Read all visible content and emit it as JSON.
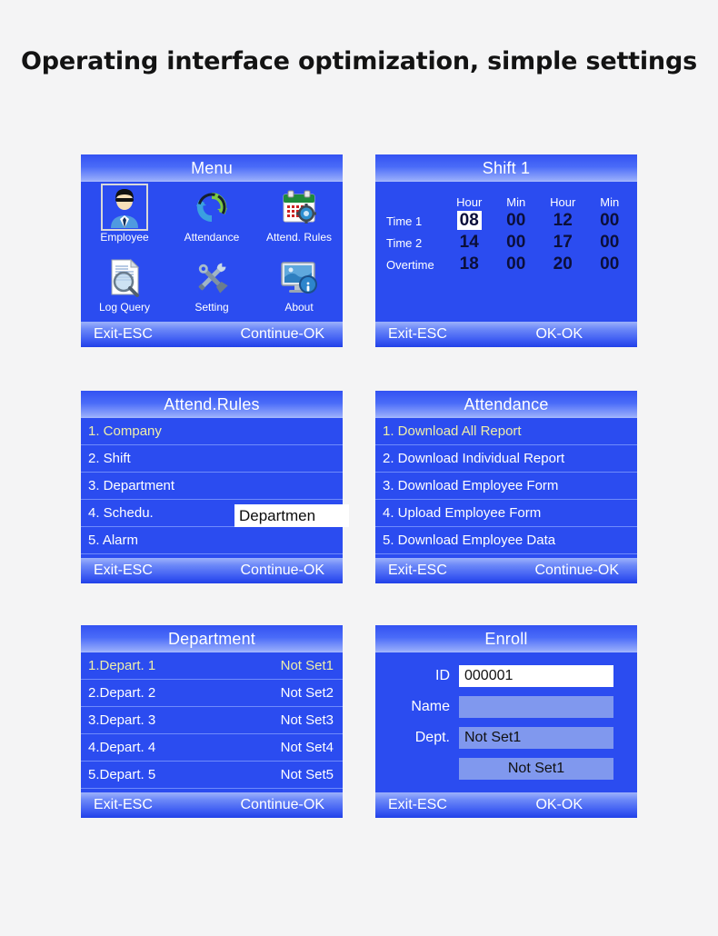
{
  "page": {
    "title": "Operating interface optimization, simple settings",
    "background": "#f4f4f5"
  },
  "colors": {
    "screen_blue": "#2b4cf0",
    "title_gradient_top": "#3352f2",
    "title_gradient_bottom": "#a9bbfc",
    "selected_text": "#eeeeaa",
    "value_text": "#0b0f3a",
    "field_tint": "#8098ee"
  },
  "panels": {
    "menu": {
      "title": "Menu",
      "items": [
        {
          "label": "Employee",
          "icon": "employee-icon",
          "selected": true
        },
        {
          "label": "Attendance",
          "icon": "attendance-icon",
          "selected": false
        },
        {
          "label": "Attend. Rules",
          "icon": "attend-rules-icon",
          "selected": false
        },
        {
          "label": "Log Query",
          "icon": "log-query-icon",
          "selected": false
        },
        {
          "label": "Setting",
          "icon": "setting-icon",
          "selected": false
        },
        {
          "label": "About",
          "icon": "about-icon",
          "selected": false
        }
      ],
      "footer_left": "Exit-ESC",
      "footer_right": "Continue-OK"
    },
    "shift": {
      "title": "Shift 1",
      "headers": [
        "Hour",
        "Min",
        "Hour",
        "Min"
      ],
      "rows": [
        {
          "label": "Time 1",
          "values": [
            "08",
            "00",
            "12",
            "00"
          ],
          "highlight_index": 0
        },
        {
          "label": "Time 2",
          "values": [
            "14",
            "00",
            "17",
            "00"
          ],
          "highlight_index": -1
        },
        {
          "label": "Overtime",
          "values": [
            "18",
            "00",
            "20",
            "00"
          ],
          "highlight_index": -1
        }
      ],
      "footer_left": "Exit-ESC",
      "footer_right": "OK-OK"
    },
    "attend_rules": {
      "title": "Attend.Rules",
      "items": [
        {
          "label": "1. Company",
          "selected": true
        },
        {
          "label": "2. Shift",
          "selected": false
        },
        {
          "label": "3. Department",
          "selected": false
        },
        {
          "label": "4. Schedu.",
          "selected": false
        },
        {
          "label": "5. Alarm",
          "selected": false
        }
      ],
      "popup_text": "Departmen",
      "footer_left": "Exit-ESC",
      "footer_right": "Continue-OK"
    },
    "attendance": {
      "title": "Attendance",
      "items": [
        {
          "label": "1. Download All Report",
          "selected": true
        },
        {
          "label": "2. Download Individual Report",
          "selected": false
        },
        {
          "label": "3. Download Employee Form",
          "selected": false
        },
        {
          "label": "4. Upload Employee Form",
          "selected": false
        },
        {
          "label": "5. Download Employee Data",
          "selected": false
        }
      ],
      "footer_left": "Exit-ESC",
      "footer_right": "Continue-OK"
    },
    "department": {
      "title": "Department",
      "items": [
        {
          "label": "1.Depart. 1",
          "value": "Not Set1",
          "selected": true
        },
        {
          "label": "2.Depart. 2",
          "value": "Not Set2",
          "selected": false
        },
        {
          "label": "3.Depart. 3",
          "value": "Not Set3",
          "selected": false
        },
        {
          "label": "4.Depart. 4",
          "value": "Not Set4",
          "selected": false
        },
        {
          "label": "5.Depart. 5",
          "value": "Not Set5",
          "selected": false
        }
      ],
      "footer_left": "Exit-ESC",
      "footer_right": "Continue-OK"
    },
    "enroll": {
      "title": "Enroll",
      "fields": [
        {
          "label": "ID",
          "value": "000001",
          "style": "white"
        },
        {
          "label": "Name",
          "value": "",
          "style": "tint"
        },
        {
          "label": "Dept.",
          "value": "Not Set1",
          "style": "tint"
        },
        {
          "label": "",
          "value": "Not Set1",
          "style": "tint-center"
        }
      ],
      "footer_left": "Exit-ESC",
      "footer_right": "OK-OK"
    }
  }
}
